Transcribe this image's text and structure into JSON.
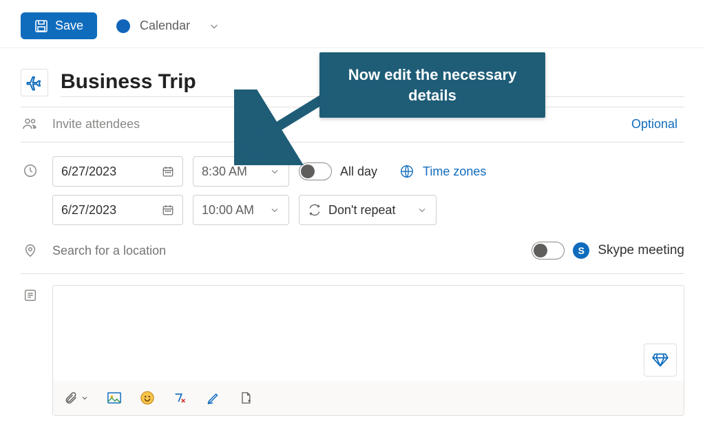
{
  "toolbar": {
    "save_label": "Save",
    "calendar_label": "Calendar"
  },
  "event": {
    "icon_name": "airplane-icon",
    "title": "Business Trip"
  },
  "attendees": {
    "placeholder": "Invite attendees",
    "optional_label": "Optional"
  },
  "datetime": {
    "start_date": "6/27/2023",
    "start_time": "8:30 AM",
    "end_date": "6/27/2023",
    "end_time": "10:00 AM",
    "all_day_label": "All day",
    "all_day_on": false,
    "time_zones_label": "Time zones",
    "repeat_label": "Don't repeat"
  },
  "location": {
    "placeholder": "Search for a location",
    "skype_label": "Skype meeting",
    "skype_on": false
  },
  "callout_text": "Now edit the necessary details"
}
